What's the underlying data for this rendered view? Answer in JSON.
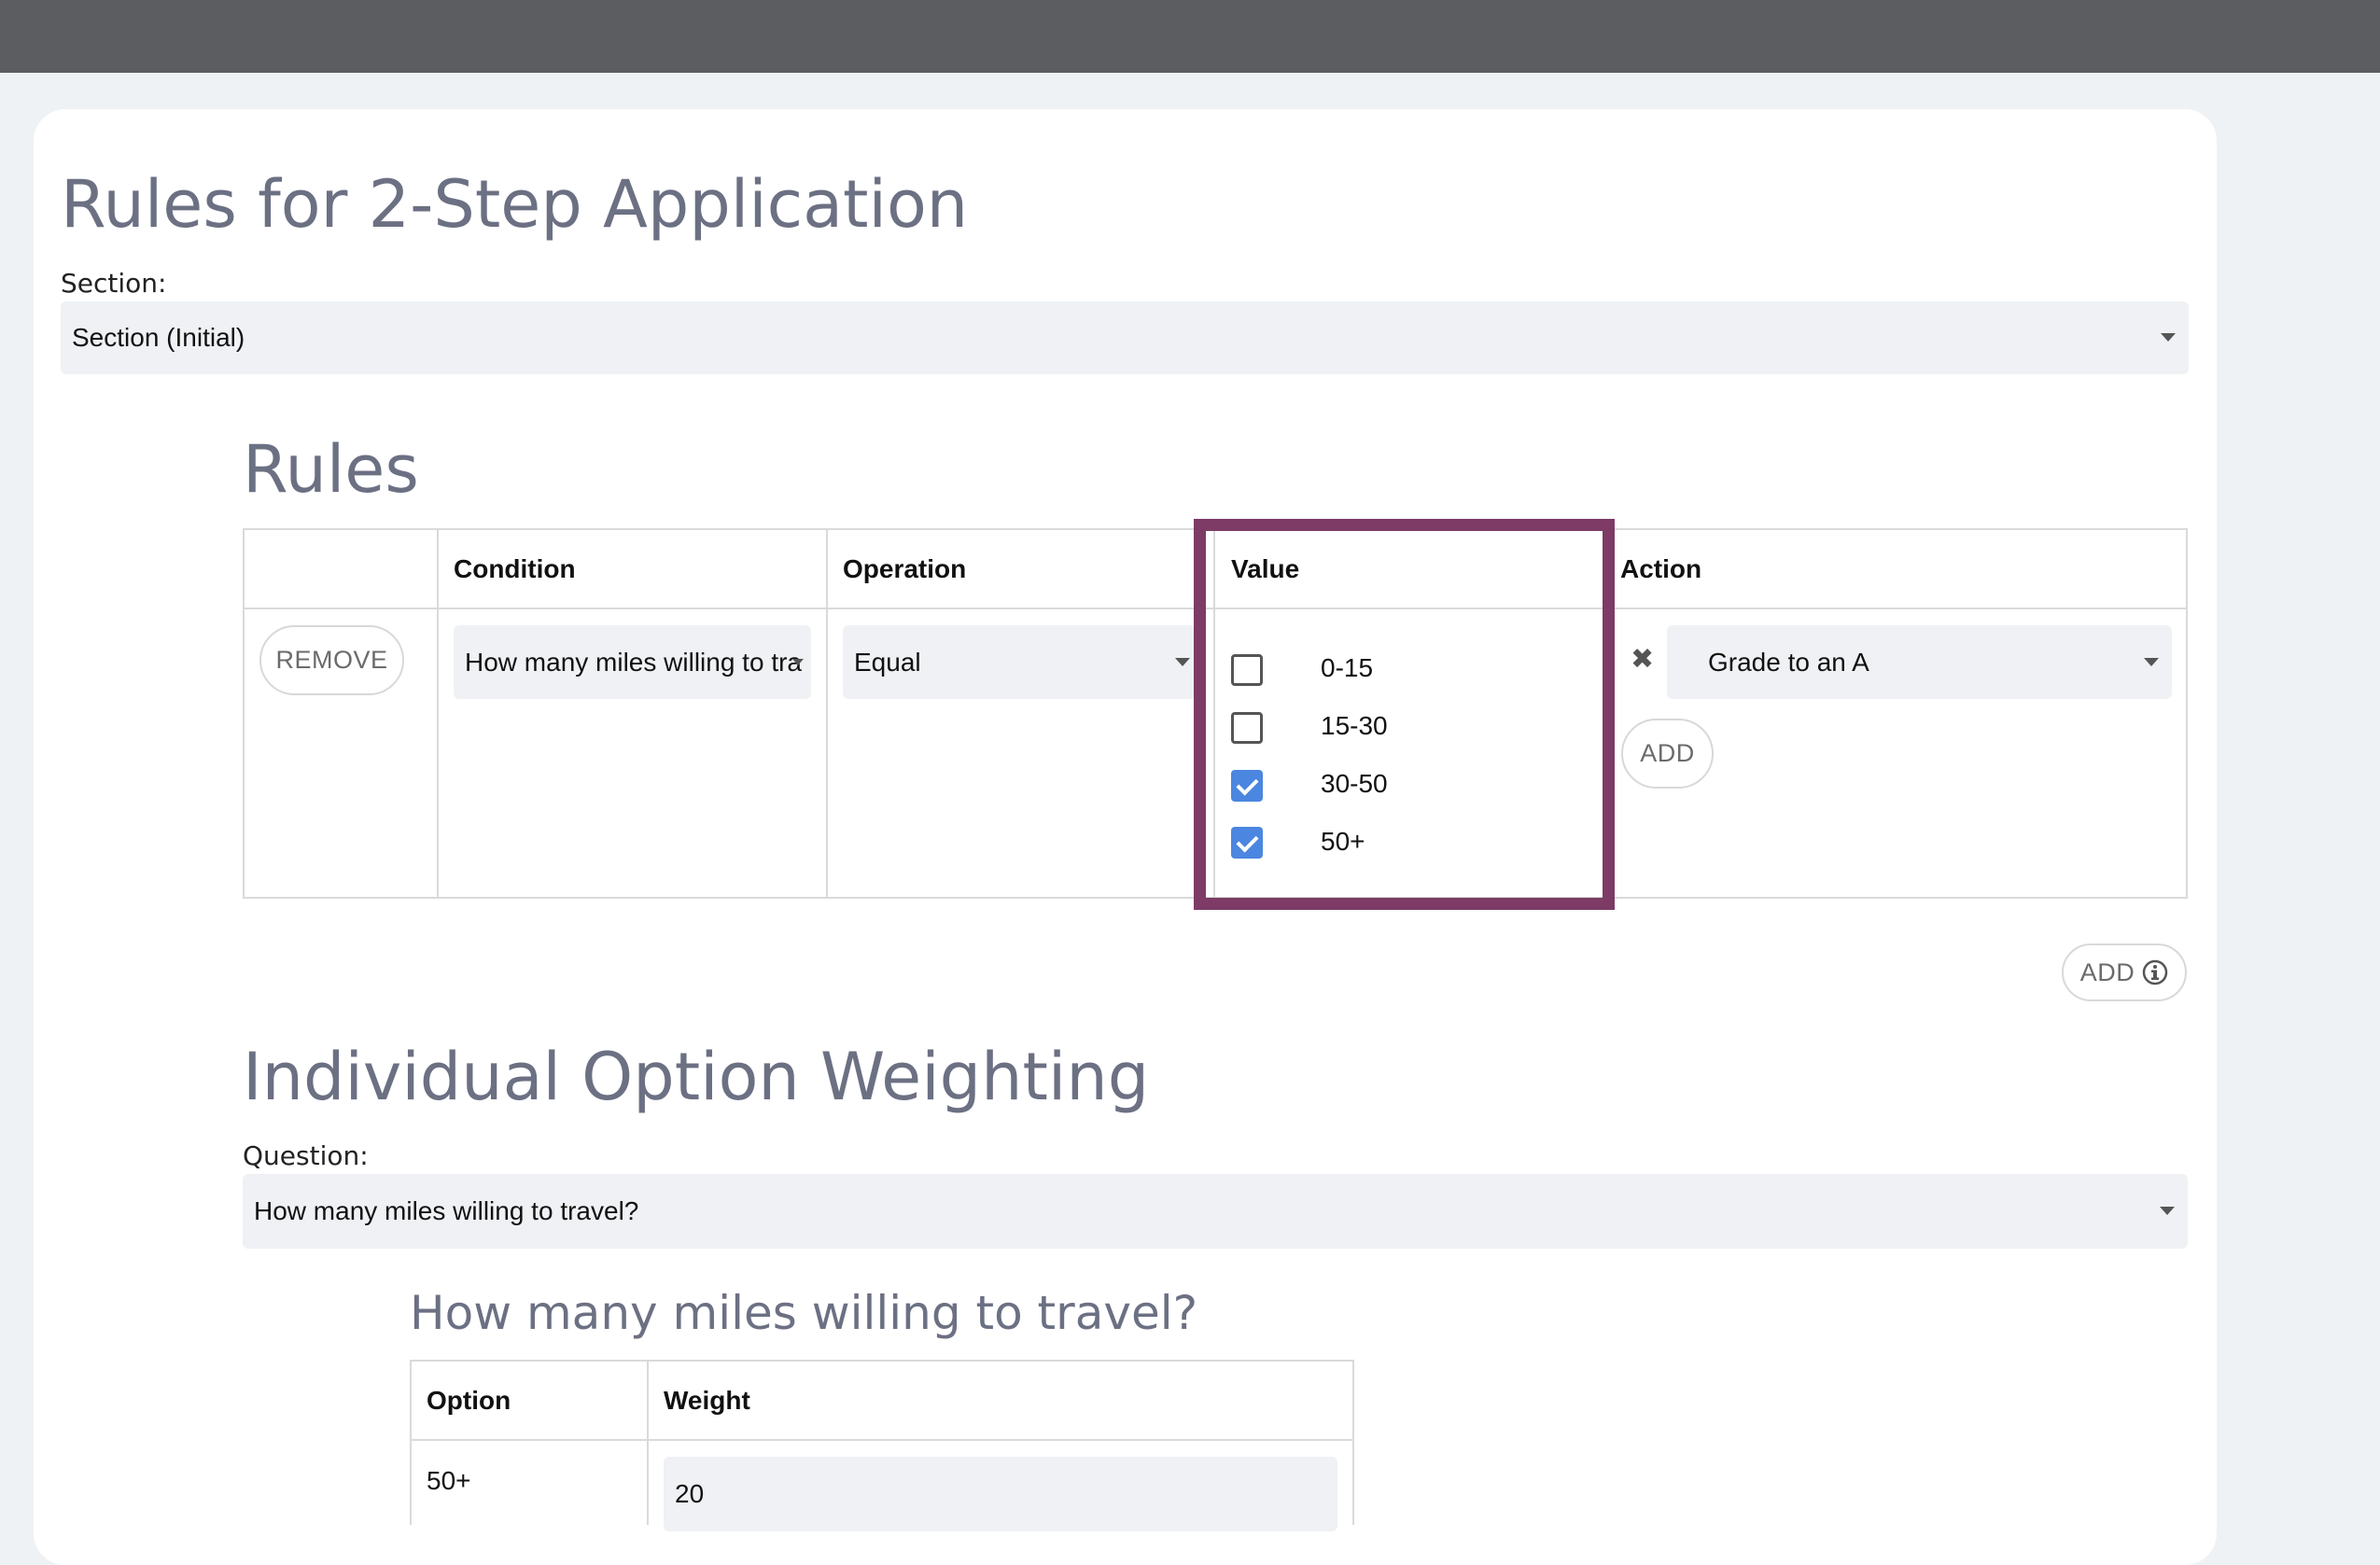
{
  "page_title": "Rules for 2-Step Application",
  "section": {
    "label": "Section:",
    "value": "Section (Initial)"
  },
  "rules": {
    "heading": "Rules",
    "columns": {
      "condition": "Condition",
      "operation": "Operation",
      "value": "Value",
      "action": "Action"
    },
    "row": {
      "remove_label": "REMOVE",
      "condition": "How many miles willing to tra",
      "operation": "Equal",
      "options": [
        {
          "label": "0-15",
          "checked": false
        },
        {
          "label": "15-30",
          "checked": false
        },
        {
          "label": "30-50",
          "checked": true
        },
        {
          "label": "50+",
          "checked": true
        }
      ],
      "action_remove_icon": "✖",
      "action": "Grade to an A",
      "action_add_label": "ADD"
    },
    "add_rule_label": "ADD",
    "add_rule_icon": "info-icon"
  },
  "weighting": {
    "heading": "Individual Option Weighting",
    "question_label": "Question:",
    "question_value": "How many miles willing to travel?",
    "subheading": "How many miles willing to travel?",
    "columns": {
      "option": "Option",
      "weight": "Weight"
    },
    "rows": [
      {
        "option": "50+",
        "weight": "20"
      }
    ]
  }
}
